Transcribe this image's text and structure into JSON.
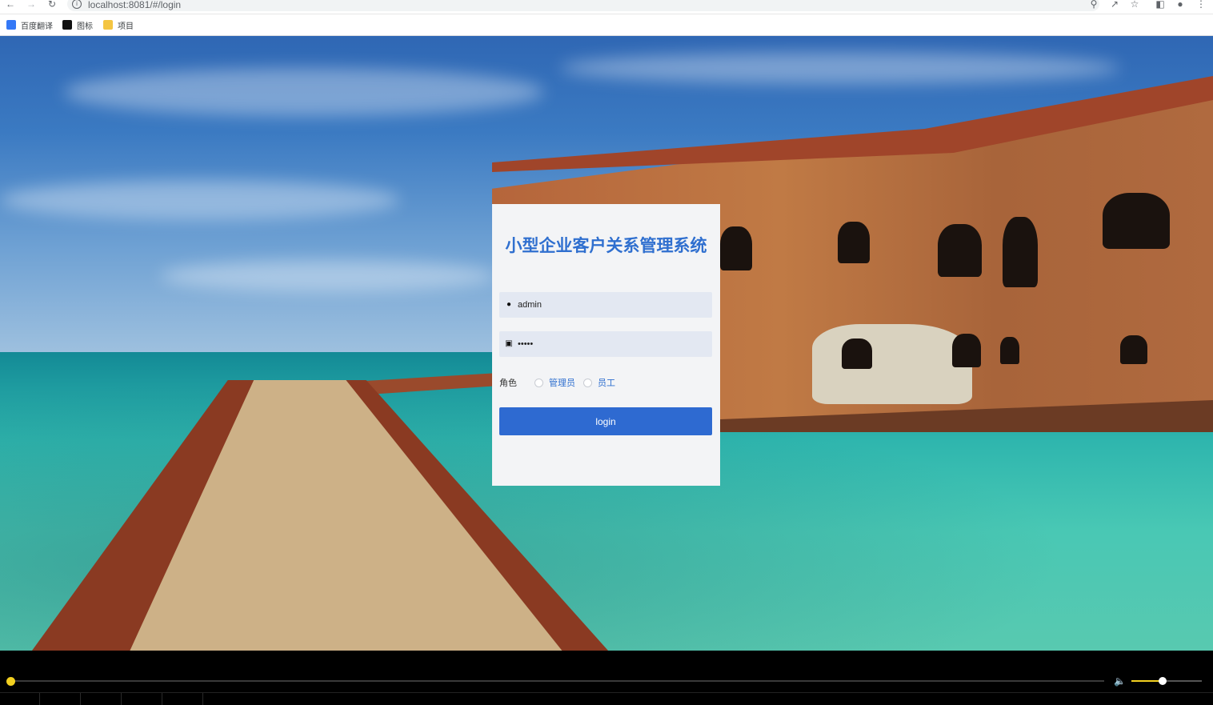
{
  "browser": {
    "url": "localhost:8081/#/login",
    "bookmarks": [
      {
        "label": "百度翻译",
        "icon": "translate-icon",
        "color": "#3478f6"
      },
      {
        "label": "图标",
        "icon": "image-icon",
        "color": "#111111"
      },
      {
        "label": "项目",
        "icon": "folder-icon",
        "color": "#f4c542"
      }
    ]
  },
  "login": {
    "title": "小型企业客户关系管理系统",
    "username": "admin",
    "password": "•••••",
    "role_label": "角色",
    "roles": [
      "管理员",
      "员工"
    ],
    "button_label": "login"
  },
  "player": {
    "progress": 0.0,
    "volume": 0.4
  },
  "colors": {
    "accent": "#2e6ad1",
    "title": "#2f6fcf",
    "player_accent": "#f2d020"
  }
}
